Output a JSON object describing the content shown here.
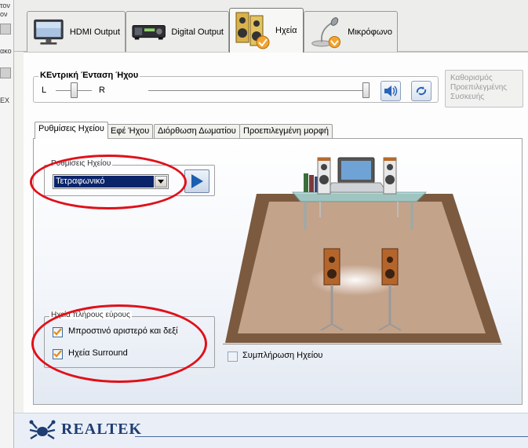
{
  "background_window": {
    "fragments": [
      "τον",
      "ον",
      "ακο",
      "ΕΧ"
    ]
  },
  "device_tabs": [
    {
      "label": "HDMI Output",
      "icon": "monitor-icon",
      "selected": false
    },
    {
      "label": "Digital Output",
      "icon": "digital-device-icon",
      "selected": false
    },
    {
      "label": "Ηχεία",
      "icon": "speakers-icon",
      "selected": true
    },
    {
      "label": "Μικρόφωνο",
      "icon": "microphone-icon",
      "selected": false
    }
  ],
  "master_volume": {
    "title": "ΚΕντρική Ένταση Ήχου",
    "left_label": "L",
    "right_label": "R",
    "balance_fraction": 0.5,
    "volume_fraction": 1.0
  },
  "set_default_button": "Καθορισμός Προεπιλεγμένης Συσκευής",
  "inner_tabs": [
    {
      "label": "Ρυθμίσεις Ηχείου",
      "selected": true
    },
    {
      "label": "Εφέ Ήχου",
      "selected": false
    },
    {
      "label": "Διόρθωση Δωματίου",
      "selected": false
    },
    {
      "label": "Προεπιλεγμένη μορφή",
      "selected": false
    }
  ],
  "speaker_config": {
    "label": "Ρυθμίσεις Ηχείου",
    "selected": "Τετραφωνικό"
  },
  "fullrange": {
    "label": "Ηχεία πλήρους εύρους",
    "front": {
      "label": "Μπροστινό αριστερό και δεξί",
      "checked": true
    },
    "surround": {
      "label": "Ηχεία Surround",
      "checked": true
    }
  },
  "virtual_surround": {
    "label": "Συμπλήρωση Ηχείου",
    "checked": false
  },
  "brand": {
    "name": "REALTEK"
  },
  "colors": {
    "annotation_red": "#e0101a",
    "brand_blue": "#1f3d73",
    "selection_blue": "#0a246a"
  }
}
